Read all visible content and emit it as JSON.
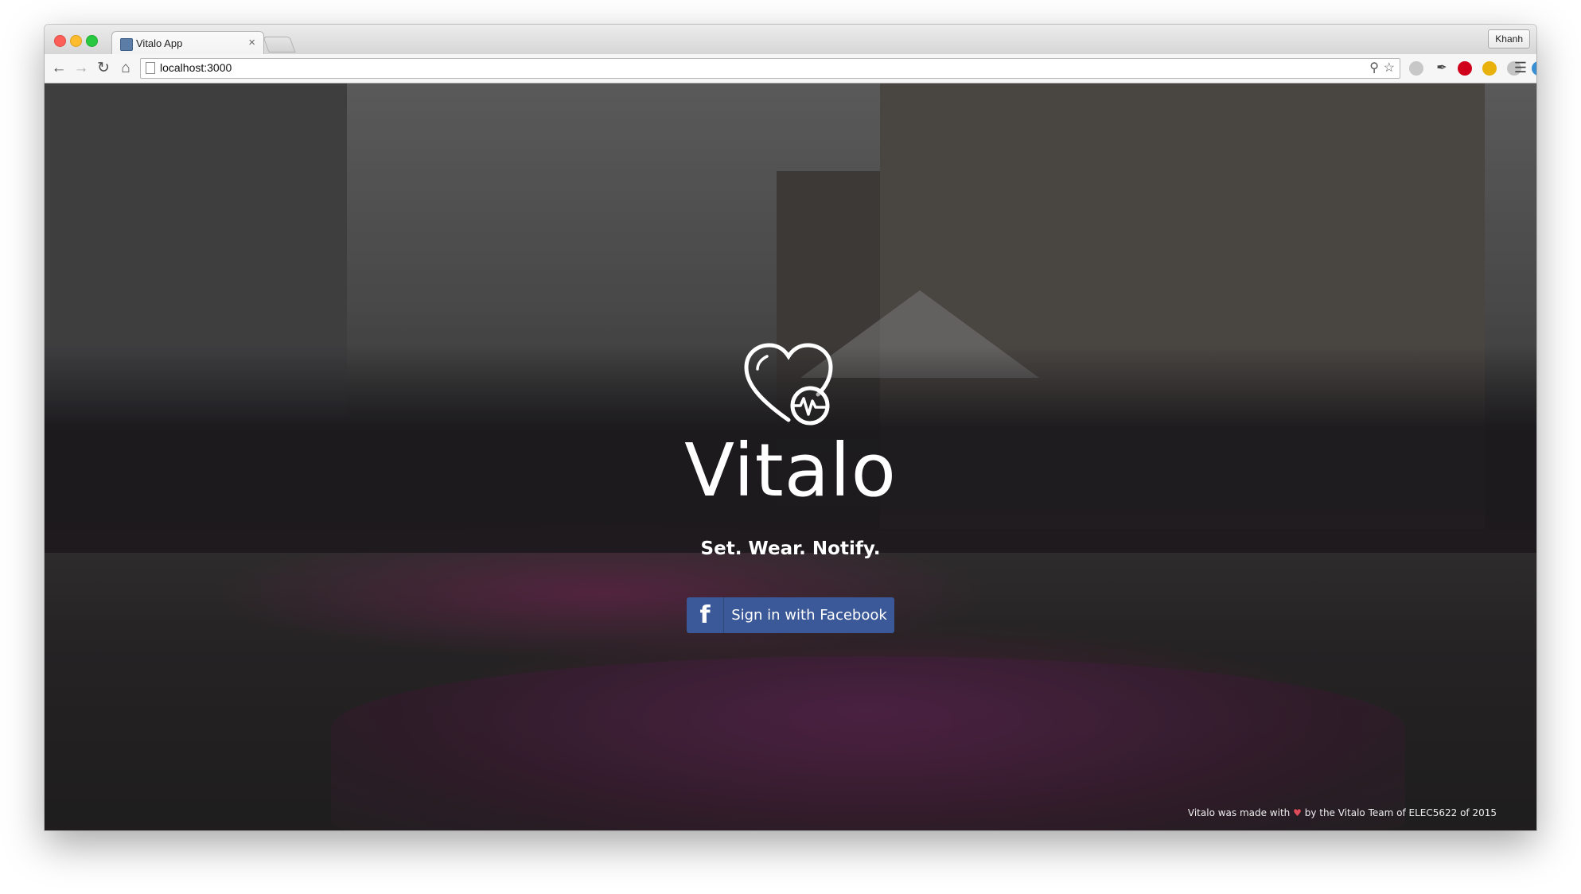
{
  "browser": {
    "tab_title": "Vitalo App",
    "tab_close": "×",
    "profile_name": "Khanh",
    "url": "localhost:3000"
  },
  "icons": {
    "back": "arrow-left-icon",
    "forward": "arrow-right-icon",
    "reload": "reload-icon",
    "home": "home-icon",
    "menu": "menu-icon"
  },
  "hero": {
    "brand": "Vitalo",
    "tagline": "Set. Wear. Notify.",
    "facebook_button": "Sign in with Facebook",
    "facebook_glyph": "f"
  },
  "footer": {
    "prefix": "Vitalo was made with",
    "heart": "♥",
    "suffix": "by the Vitalo Team of ELEC5622 of 2015"
  },
  "colors": {
    "facebook_blue": "#3b5998",
    "heart": "#e24b5a"
  }
}
